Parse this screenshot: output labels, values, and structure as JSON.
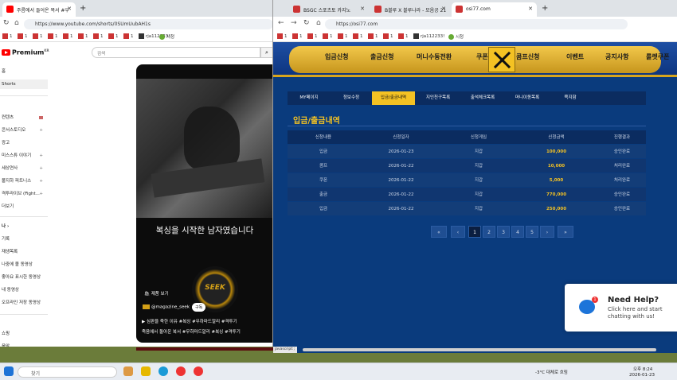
{
  "left_browser": {
    "tabs": [
      {
        "label": "주름에서 들어온 복서 #우"
      }
    ],
    "url": "https://www.youtube.com/shorts/0SUmUubAH1s",
    "bookmarks": [
      "1",
      "1",
      "1",
      "1",
      "1",
      "1",
      "1",
      "1",
      "1",
      "rja112233!",
      "시청"
    ],
    "yt_logo": "Premium",
    "yt_logo_sup": "KR",
    "search_placeholder": "검색",
    "sidebar": [
      {
        "label": "홈"
      },
      {
        "label": "Shorts"
      },
      {
        "label": "컨텐츠"
      },
      {
        "label": "콘서스토디오"
      },
      {
        "label": "광고"
      },
      {
        "label": "미스스튜 이야기"
      },
      {
        "label": "세상연사"
      },
      {
        "label": "볼지하 피트니스"
      },
      {
        "label": "격투라이브 (Fight..."
      },
      {
        "label": "더보기"
      },
      {
        "label": "나"
      },
      {
        "label": "기록"
      },
      {
        "label": "재생목록"
      },
      {
        "label": "나중에 볼 동영상"
      },
      {
        "label": "좋아요 표시한 동영상"
      },
      {
        "label": "내 동영상"
      },
      {
        "label": "오프라인 저장 동영상"
      },
      {
        "label": "쇼핑"
      },
      {
        "label": "음악"
      }
    ],
    "video": {
      "caption": "복싱을 시작한 남자였습니다",
      "badge": "SEEK",
      "product": "제품 보기",
      "channel": "@magazine_seek",
      "subscribe": "구독",
      "line1": "▶ 심판을 죽한 이유 #복싱 #무하마드알리 #격투기",
      "line2": "죽음에서 돌아온 복서 #무하마드알리 #복싱 #격투기"
    }
  },
  "right_browser": {
    "tabs": [
      {
        "label": "BSGC 스포츠토 카지노"
      },
      {
        "label": "B블루 X 블루나라 - 모음공 21"
      },
      {
        "label": "osi77.com"
      }
    ],
    "url": "https://osi77.com",
    "bookmarks": [
      "1",
      "1",
      "1",
      "1",
      "1",
      "1",
      "1",
      "1",
      "1",
      "rja112233!",
      "시청"
    ],
    "menu": [
      "입금신청",
      "출금신청",
      "머니수동전환",
      "쿠폰",
      "콤프신청",
      "이벤트",
      "공지사항",
      "룰렛쿠폰"
    ],
    "subtabs": [
      "MY페이지",
      "정보수정",
      "입금/출금내역",
      "지인친구목록",
      "출석체크목록",
      "머니이동목록",
      "쪽지함"
    ],
    "active_subtab": "입금/출금내역",
    "page_title": "입금/출금내역",
    "table": {
      "headers": [
        "신청내용",
        "신청일자",
        "신청게임",
        "신청금액",
        "진행결과"
      ],
      "rows": [
        [
          "입금",
          "2026-01-23",
          "지갑",
          "100,000",
          "승인완료"
        ],
        [
          "콤프",
          "2026-01-22",
          "지갑",
          "10,000",
          "처리완료"
        ],
        [
          "쿠폰",
          "2026-01-22",
          "지갑",
          "5,000",
          "처리완료"
        ],
        [
          "출금",
          "2026-01-22",
          "지갑",
          "770,000",
          "승인완료"
        ],
        [
          "입금",
          "2026-01-22",
          "지갑",
          "250,000",
          "승인완료"
        ]
      ]
    },
    "pagination": [
      "«",
      "‹",
      "1",
      "2",
      "3",
      "4",
      "5",
      "›",
      "»"
    ],
    "current_page": "1",
    "status": "javascript:;",
    "help": {
      "title": "Need Help?",
      "sub": "Click here and start chatting with us!",
      "badge": "1"
    }
  },
  "taskbar": {
    "search": "찾기",
    "weather": "-3°C 대체로 흐림",
    "time": "오후 8:24",
    "date": "2026-01-23"
  }
}
